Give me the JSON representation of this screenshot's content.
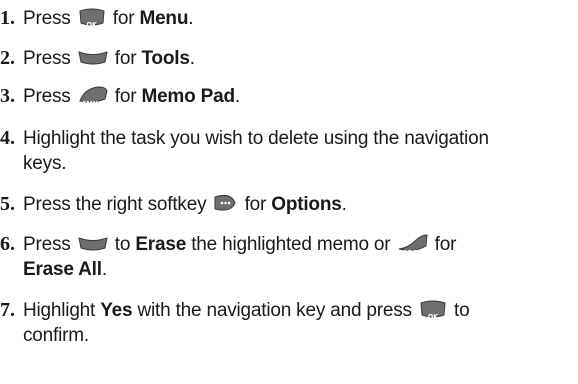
{
  "steps": [
    {
      "num": "1.",
      "pre": "Press",
      "key": "ok-key",
      "key_text": "OK",
      "mid": "for",
      "bold": "Menu",
      "post": "."
    },
    {
      "num": "2.",
      "pre": "Press",
      "key": "5-key",
      "key_text": "5JKL",
      "mid": "for",
      "bold": "Tools",
      "post": "."
    },
    {
      "num": "3.",
      "pre": "Press",
      "key": "6-key",
      "key_text": "6MNO",
      "mid": "for",
      "bold": "Memo Pad",
      "post": "."
    },
    {
      "num": "4.",
      "line1": "Highlight the task you wish to delete using the navigation",
      "line2": "keys."
    },
    {
      "num": "5.",
      "pre": "Press the right softkey",
      "key": "right-softkey",
      "mid": "for",
      "bold": "Options",
      "post": "."
    },
    {
      "num": "6.",
      "pre": "Press",
      "key": "2-key",
      "key_text": "2ABC",
      "mid": "to",
      "bold": "Erase",
      "after": "the highlighted memo or",
      "key2": "3-key",
      "key2_text": "3DEF",
      "mid2": "for",
      "bold2": "Erase All",
      "post": "."
    },
    {
      "num": "7.",
      "pre": "Highlight",
      "bold": "Yes",
      "after": "with the navigation key and press",
      "key": "ok-key",
      "key_text": "OK",
      "mid": "to",
      "line2": "confirm."
    }
  ]
}
